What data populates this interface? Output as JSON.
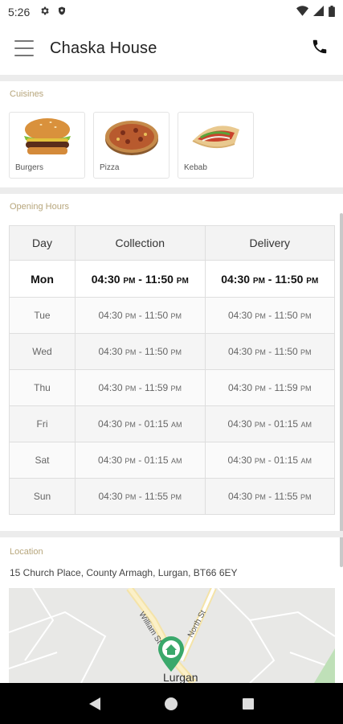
{
  "status_bar": {
    "time": "5:26",
    "icons": [
      "gear-icon",
      "shield-icon"
    ],
    "right_icons": [
      "wifi-icon",
      "signal-icon",
      "battery-icon"
    ]
  },
  "app_bar": {
    "title": "Chaska House",
    "menu_icon": "hamburger-menu-icon",
    "action_icon": "phone-icon"
  },
  "cuisines": {
    "label": "Cuisines",
    "items": [
      {
        "name": "Burgers",
        "icon": "burger-image"
      },
      {
        "name": "Pizza",
        "icon": "pizza-image"
      },
      {
        "name": "Kebab",
        "icon": "kebab-image"
      }
    ]
  },
  "opening_hours": {
    "label": "Opening Hours",
    "headers": [
      "Day",
      "Collection",
      "Delivery"
    ],
    "today": "Mon",
    "rows": [
      {
        "day": "Mon",
        "collection": {
          "open": "04:30",
          "open_ampm": "PM",
          "close": "11:50",
          "close_ampm": "PM"
        },
        "delivery": {
          "open": "04:30",
          "open_ampm": "PM",
          "close": "11:50",
          "close_ampm": "PM"
        }
      },
      {
        "day": "Tue",
        "collection": {
          "open": "04:30",
          "open_ampm": "PM",
          "close": "11:50",
          "close_ampm": "PM"
        },
        "delivery": {
          "open": "04:30",
          "open_ampm": "PM",
          "close": "11:50",
          "close_ampm": "PM"
        }
      },
      {
        "day": "Wed",
        "collection": {
          "open": "04:30",
          "open_ampm": "PM",
          "close": "11:50",
          "close_ampm": "PM"
        },
        "delivery": {
          "open": "04:30",
          "open_ampm": "PM",
          "close": "11:50",
          "close_ampm": "PM"
        }
      },
      {
        "day": "Thu",
        "collection": {
          "open": "04:30",
          "open_ampm": "PM",
          "close": "11:59",
          "close_ampm": "PM"
        },
        "delivery": {
          "open": "04:30",
          "open_ampm": "PM",
          "close": "11:59",
          "close_ampm": "PM"
        }
      },
      {
        "day": "Fri",
        "collection": {
          "open": "04:30",
          "open_ampm": "PM",
          "close": "01:15",
          "close_ampm": "AM"
        },
        "delivery": {
          "open": "04:30",
          "open_ampm": "PM",
          "close": "01:15",
          "close_ampm": "AM"
        }
      },
      {
        "day": "Sat",
        "collection": {
          "open": "04:30",
          "open_ampm": "PM",
          "close": "01:15",
          "close_ampm": "AM"
        },
        "delivery": {
          "open": "04:30",
          "open_ampm": "PM",
          "close": "01:15",
          "close_ampm": "AM"
        }
      },
      {
        "day": "Sun",
        "collection": {
          "open": "04:30",
          "open_ampm": "PM",
          "close": "11:55",
          "close_ampm": "PM"
        },
        "delivery": {
          "open": "04:30",
          "open_ampm": "PM",
          "close": "11:55",
          "close_ampm": "PM"
        }
      }
    ]
  },
  "location": {
    "label": "Location",
    "address": "15 Church Place, County Armagh, Lurgan, BT66 6EY",
    "map": {
      "streets": [
        "William St",
        "North St"
      ],
      "town": "Lurgan",
      "pin_icon": "home-pin-icon",
      "pin_color": "#3aa86b"
    }
  },
  "nav_bar": {
    "buttons": [
      "back-icon",
      "home-icon",
      "recents-icon"
    ]
  },
  "colors": {
    "section_label": "#b7a67c",
    "divider": "#ececec"
  }
}
